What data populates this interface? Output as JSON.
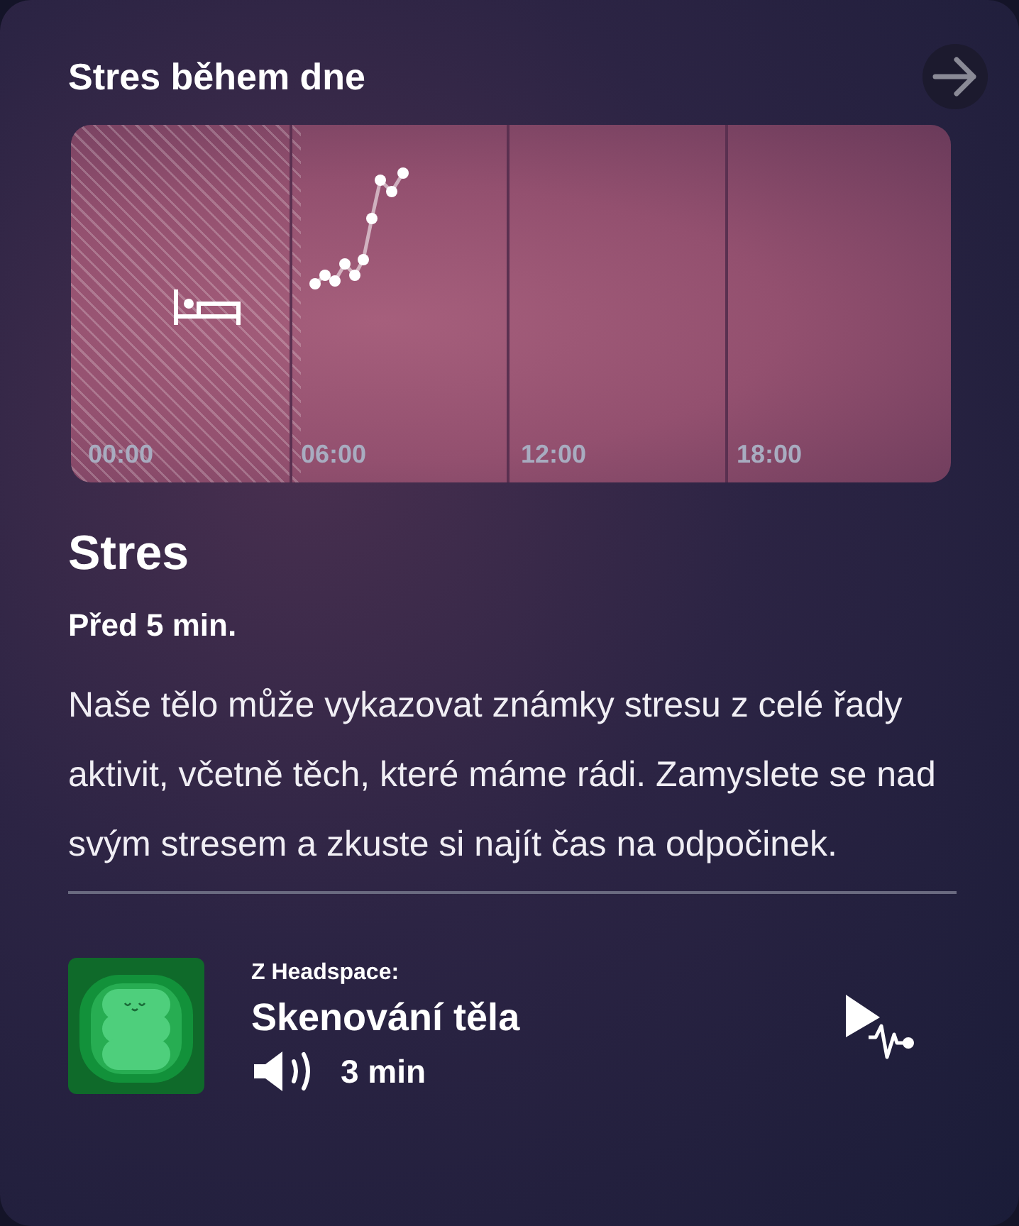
{
  "header": {
    "title": "Stres během dne"
  },
  "chart": {
    "time_labels": [
      "00:00",
      "06:00",
      "12:00",
      "18:00"
    ]
  },
  "stress": {
    "heading": "Stres",
    "time": "Před 5 min.",
    "description": "Naše tělo může vykazovat známky stresu z celé řady aktivit, včetně těch, které máme rádi. Zamyslete se nad svým stresem a zkuste si najít čas na odpočinek."
  },
  "meditation": {
    "source": "Z Headspace:",
    "title": "Skenování těla",
    "duration": "3 min"
  }
}
